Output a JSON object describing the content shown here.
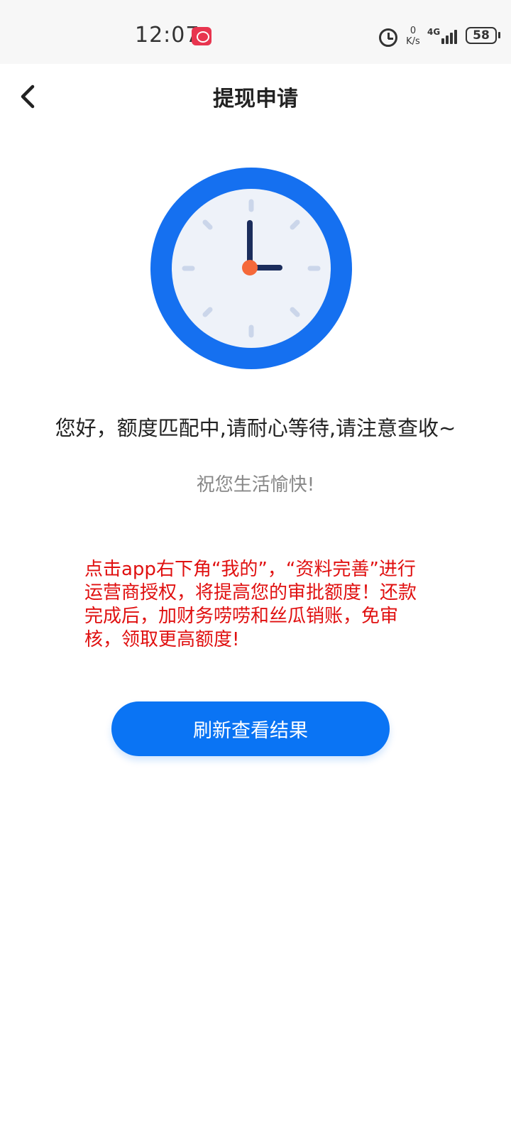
{
  "status_bar": {
    "time": "12:07",
    "net_speed_value": "0",
    "net_speed_unit": "K/s",
    "network": "4G",
    "battery": "58"
  },
  "nav": {
    "title": "提现申请"
  },
  "illustration": {
    "icon": "clock-icon",
    "colors": {
      "ring": "#1570f0",
      "face": "#eef2f9",
      "hands": "#1b2d5c",
      "center": "#f5693a",
      "ticks": "#cbd6ea"
    }
  },
  "content": {
    "main_message": "您好，额度匹配中,请耐心等待,请注意查收~",
    "sub_message": "祝您生活愉快!",
    "notice": "点击app右下角“我的”，“资料完善”进行运营商授权，将提高您的审批额度！还款完成后，加财务唠唠和丝瓜销账，免审核，领取更高额度!"
  },
  "actions": {
    "refresh_label": "刷新查看结果"
  },
  "colors": {
    "primary": "#0a74f4",
    "notice": "#e01010"
  }
}
